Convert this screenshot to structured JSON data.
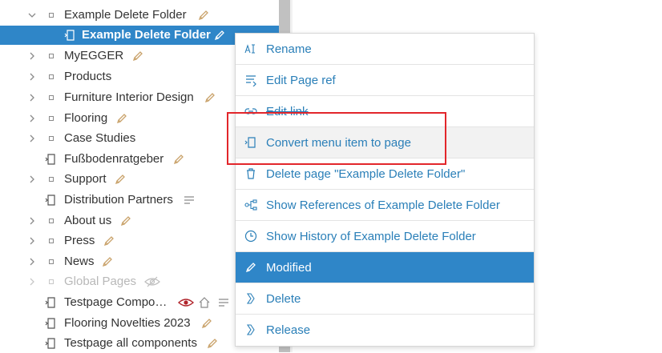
{
  "tree": {
    "items": [
      {
        "label": "Example Delete Folder"
      },
      {
        "label": "Example Delete Folder"
      },
      {
        "label": "MyEGGER"
      },
      {
        "label": "Products"
      },
      {
        "label": "Furniture Interior Design"
      },
      {
        "label": "Flooring"
      },
      {
        "label": "Case Studies"
      },
      {
        "label": "Fußbodenratgeber"
      },
      {
        "label": "Support"
      },
      {
        "label": "Distribution Partners"
      },
      {
        "label": "About us"
      },
      {
        "label": "Press"
      },
      {
        "label": "News"
      },
      {
        "label": "Global Pages"
      },
      {
        "label": "Testpage Compo…"
      },
      {
        "label": "Flooring Novelties 2023"
      },
      {
        "label": "Testpage all components"
      }
    ]
  },
  "context_menu": {
    "items": [
      {
        "label": "Rename"
      },
      {
        "label": "Edit Page ref"
      },
      {
        "label": "Edit link"
      },
      {
        "label": "Convert menu item to page"
      },
      {
        "label": "Delete page \"Example Delete Folder\""
      },
      {
        "label": "Show References of Example Delete Folder"
      },
      {
        "label": "Show History of Example Delete Folder"
      },
      {
        "label": "Modified"
      },
      {
        "label": "Delete"
      },
      {
        "label": "Release"
      }
    ]
  },
  "colors": {
    "accent": "#2f86c8",
    "link": "#2a7fb8",
    "edit_pencil": "#c9a26a",
    "hidden_eye": "#b0232a",
    "highlight": "#e2262b"
  }
}
